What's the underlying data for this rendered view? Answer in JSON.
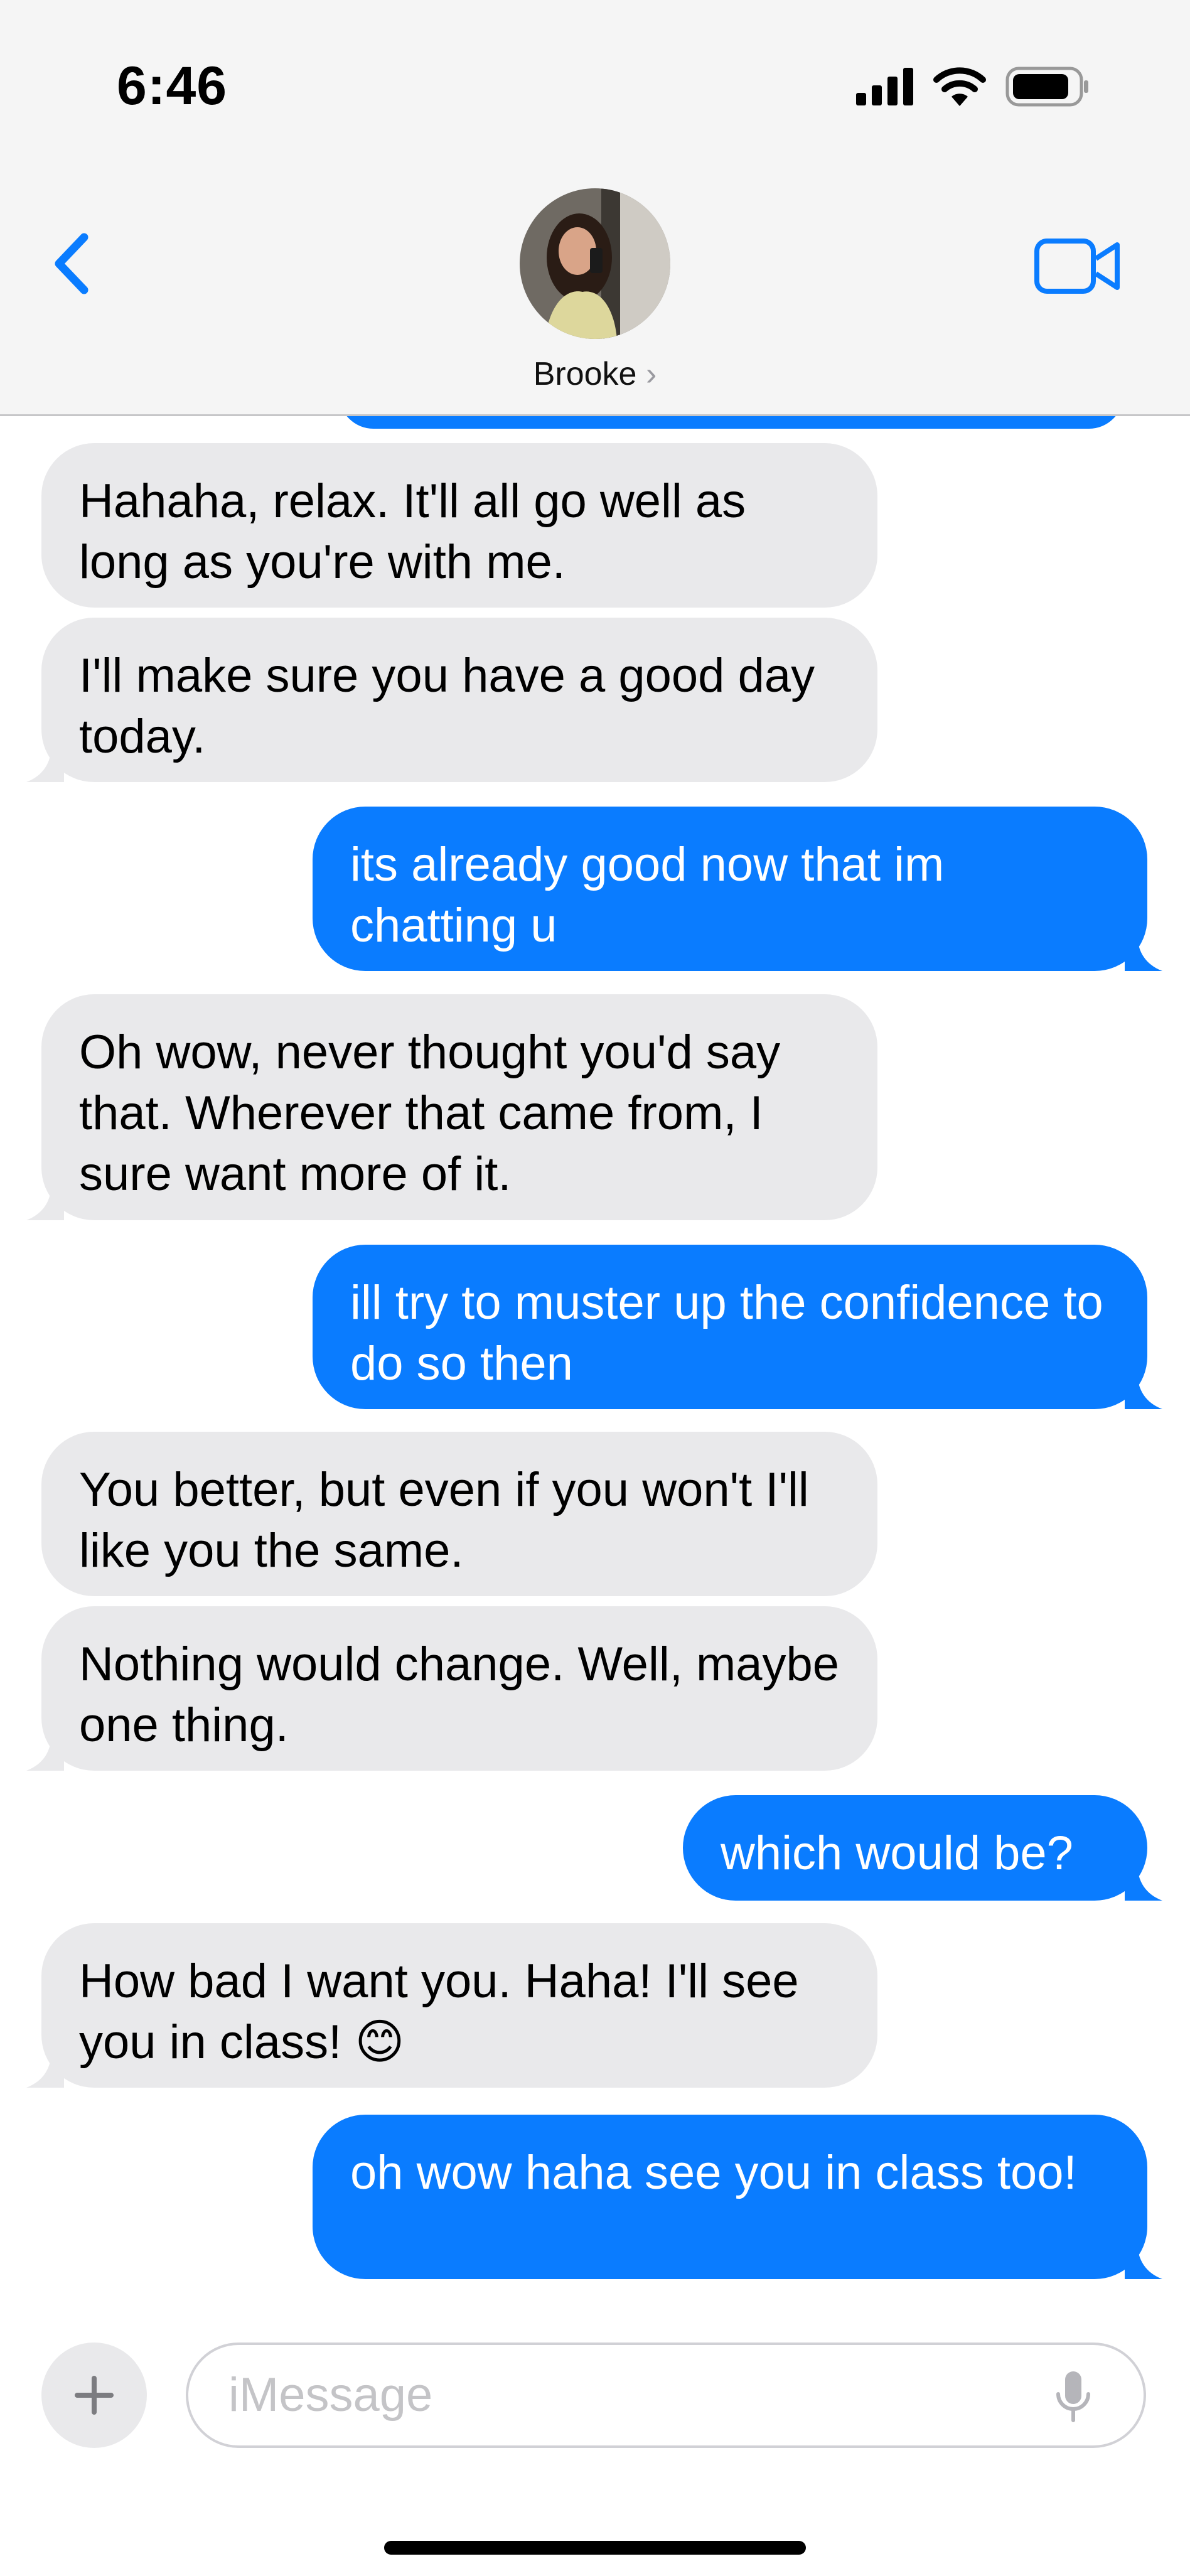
{
  "status_bar": {
    "time": "6:46",
    "icons": [
      "cellular-signal-icon",
      "wifi-icon",
      "battery-icon"
    ]
  },
  "nav": {
    "back_icon": "chevron-left-icon",
    "contact_name": "Brooke",
    "contact_chevron": "›",
    "video_icon": "video-camera-icon",
    "accent_color": "#0a7cff"
  },
  "messages": [
    {
      "side": "incoming",
      "text": "Hahaha, relax. It'll all go well as long as you're with me."
    },
    {
      "side": "incoming",
      "text": "I'll make sure you have a good day today."
    },
    {
      "side": "outgoing",
      "text": "its already good now that im chatting u"
    },
    {
      "side": "incoming",
      "text": "Oh wow, never thought you'd say that. Wherever that came from, I sure want more of it."
    },
    {
      "side": "outgoing",
      "text": "ill try to muster up the confidence to do so then"
    },
    {
      "side": "incoming",
      "text": "You better, but even if you won't I'll like you the same."
    },
    {
      "side": "incoming",
      "text": "Nothing would change. Well, maybe one thing."
    },
    {
      "side": "outgoing",
      "text": "which would be?"
    },
    {
      "side": "incoming",
      "text": "How bad I want you. Haha! I'll see you in class! 😊"
    },
    {
      "side": "outgoing",
      "text": "oh wow haha see you in class too!"
    }
  ],
  "composer": {
    "plus_icon": "plus-icon",
    "placeholder": "iMessage",
    "mic_icon": "microphone-icon"
  },
  "colors": {
    "incoming_bubble": "#e9e9eb",
    "outgoing_bubble": "#0a7cff"
  }
}
